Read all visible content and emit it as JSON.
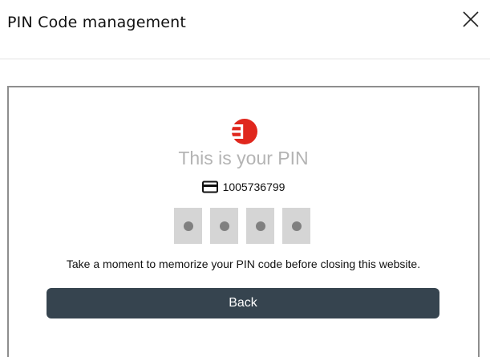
{
  "dialog": {
    "title": "PIN Code management",
    "close_icon": "close-icon"
  },
  "pin_panel": {
    "logo_icon": "brand-logo-icon",
    "logo_color": "#e0271d",
    "title": "This is your PIN",
    "card_icon": "credit-card-icon",
    "card_number": "1005736799",
    "pin_digit_count": 4,
    "memorize_message": "Take a moment to memorize your PIN code before closing this website.",
    "back_label": "Back"
  },
  "colors": {
    "button_bg": "#36444f",
    "pin_box_bg": "#d5d5d5",
    "pin_dot": "#808080",
    "title_muted": "#b4b4b4"
  }
}
